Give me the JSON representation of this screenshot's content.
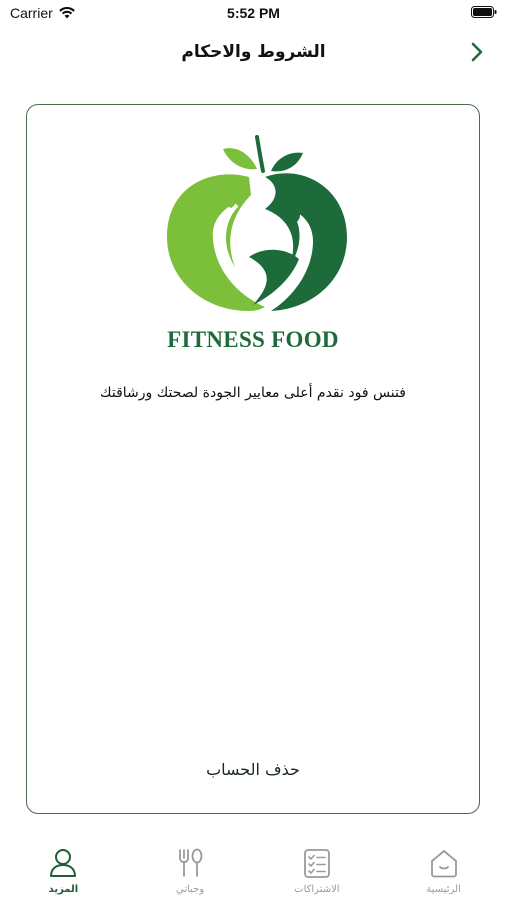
{
  "status_bar": {
    "carrier": "Carrier",
    "time": "5:52 PM"
  },
  "header": {
    "title": "الشروط والاحكام"
  },
  "card": {
    "brand_name": "FITNESS FOOD",
    "tagline": "فتنس فود  نقدم أعلى معايير الجودة لصحتك ورشاقتك",
    "delete_account": "حذف الحساب"
  },
  "tab_bar": {
    "items": [
      {
        "label": "المزيد",
        "icon": "person-icon",
        "active": true
      },
      {
        "label": "وجباتي",
        "icon": "fork-spoon-icon",
        "active": false
      },
      {
        "label": "الاشتراكات",
        "icon": "checklist-icon",
        "active": false
      },
      {
        "label": "الرئيسية",
        "icon": "home-icon",
        "active": false
      }
    ]
  },
  "colors": {
    "brand_dark_green": "#1d6b3a",
    "brand_light_green": "#7cbf3b",
    "active_tab": "#1d5e34",
    "inactive_tab": "#9a9a9a",
    "card_border": "#4c6a4c"
  }
}
